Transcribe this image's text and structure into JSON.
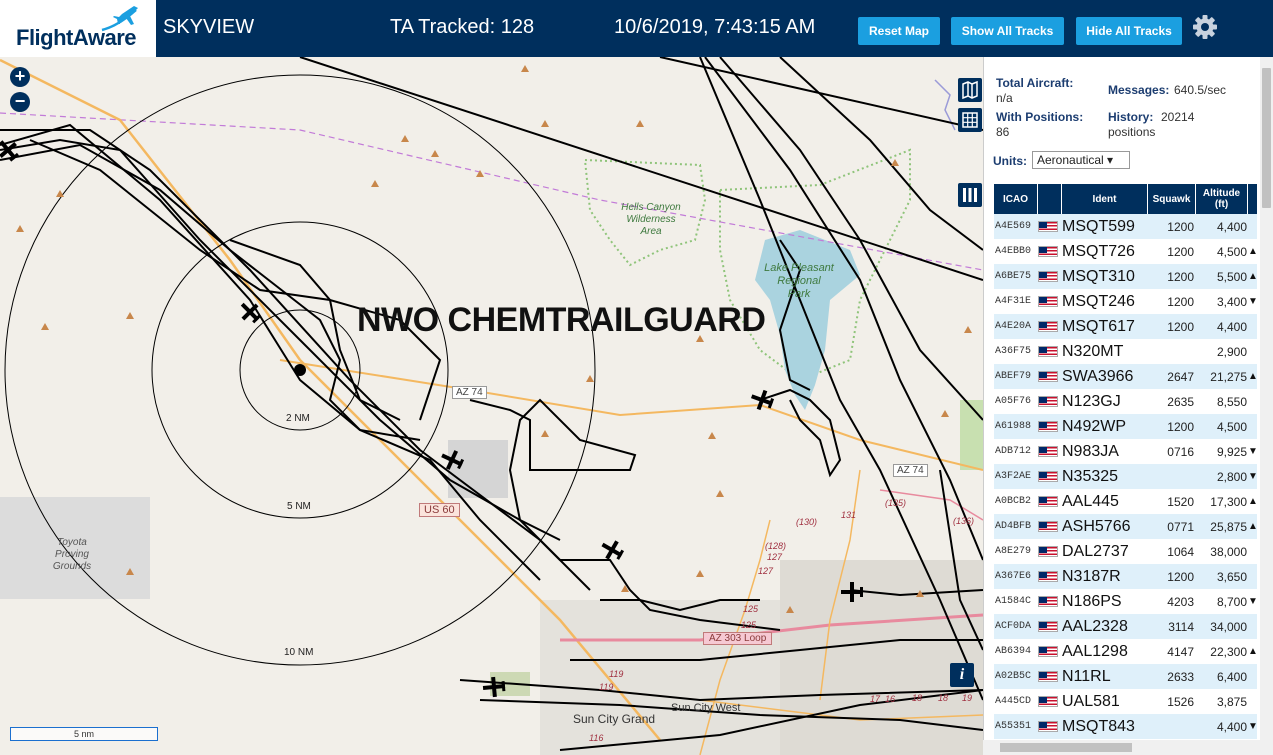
{
  "header": {
    "logo_text": "FlightAware",
    "app_title": "SKYVIEW",
    "ta_tracked": "TA Tracked: 128",
    "datetime": "10/6/2019, 7:43:15 AM",
    "reset_label": "Reset Map",
    "show_label": "Show All Tracks",
    "hide_label": "Hide All Tracks",
    "settings_icon": "gear-icon"
  },
  "map": {
    "overlay_title": "NWO CHEMTRAILGUARD",
    "zoom_in": "+",
    "zoom_out": "−",
    "scale_label": "5 nm",
    "info_label": "i",
    "ring_labels": [
      "2 NM",
      "5 NM",
      "10 NM"
    ],
    "place_labels": {
      "hells_canyon": [
        "Hells Canyon",
        "Wilderness",
        "Area"
      ],
      "lake_pleasant": [
        "Lake Pleasant",
        "Regional",
        "Park"
      ],
      "toyota": [
        "Toyota",
        "Proving",
        "Grounds"
      ],
      "sun_city_grand": "Sun City Grand",
      "sun_city_west": "Sun City West"
    },
    "road_labels": {
      "az74_a": "AZ 74",
      "az74_b": "AZ 74",
      "us60": "US 60",
      "az303": "AZ 303 Loop"
    },
    "route_numbers": [
      "(130)",
      "131",
      "(135)",
      "(136)",
      "(128)",
      "127",
      "127",
      "125",
      "125",
      "119",
      "119",
      "116",
      "17",
      "16",
      "18",
      "18",
      "19"
    ],
    "colors": {
      "track": "#000000",
      "ring": "#000000",
      "road_major": "#f4b860",
      "water": "#aad3df",
      "park_border": "#8fc47a",
      "urban": "#dddddd",
      "boundary": "#c27bd8"
    }
  },
  "sidebar": {
    "total_aircraft_label": "Total Aircraft:",
    "total_aircraft_value": "n/a",
    "with_positions_label": "With Positions:",
    "with_positions_value": "86",
    "messages_label": "Messages:",
    "messages_value": "640.5/sec",
    "history_label": "History:",
    "history_value": "20214",
    "history_unit": "positions",
    "units_label": "Units:",
    "units_value": "Aeronautical ▾",
    "table": {
      "headers": {
        "icao": "ICAO",
        "ident": "Ident",
        "squawk": "Squawk",
        "altitude": "Altitude",
        "altitude_unit": "(ft)"
      },
      "rows": [
        {
          "icao": "A4E569",
          "ident": "MSQT599",
          "squawk": "1200",
          "alt": "4,400",
          "trend": ""
        },
        {
          "icao": "A4EBB0",
          "ident": "MSQT726",
          "squawk": "1200",
          "alt": "4,500",
          "trend": "▲"
        },
        {
          "icao": "A6BE75",
          "ident": "MSQT310",
          "squawk": "1200",
          "alt": "5,500",
          "trend": "▲"
        },
        {
          "icao": "A4F31E",
          "ident": "MSQT246",
          "squawk": "1200",
          "alt": "3,400",
          "trend": "▼"
        },
        {
          "icao": "A4E20A",
          "ident": "MSQT617",
          "squawk": "1200",
          "alt": "4,400",
          "trend": ""
        },
        {
          "icao": "A36F75",
          "ident": "N320MT",
          "squawk": "",
          "alt": "2,900",
          "trend": ""
        },
        {
          "icao": "ABEF79",
          "ident": "SWA3966",
          "squawk": "2647",
          "alt": "21,275",
          "trend": "▲"
        },
        {
          "icao": "A05F76",
          "ident": "N123GJ",
          "squawk": "2635",
          "alt": "8,550",
          "trend": ""
        },
        {
          "icao": "A61988",
          "ident": "N492WP",
          "squawk": "1200",
          "alt": "4,500",
          "trend": ""
        },
        {
          "icao": "ADB712",
          "ident": "N983JA",
          "squawk": "0716",
          "alt": "9,925",
          "trend": "▼"
        },
        {
          "icao": "A3F2AE",
          "ident": "N35325",
          "squawk": "",
          "alt": "2,800",
          "trend": "▼"
        },
        {
          "icao": "A0BCB2",
          "ident": "AAL445",
          "squawk": "1520",
          "alt": "17,300",
          "trend": "▲"
        },
        {
          "icao": "AD4BFB",
          "ident": "ASH5766",
          "squawk": "0771",
          "alt": "25,875",
          "trend": "▲"
        },
        {
          "icao": "A8E279",
          "ident": "DAL2737",
          "squawk": "1064",
          "alt": "38,000",
          "trend": ""
        },
        {
          "icao": "A367E6",
          "ident": "N3187R",
          "squawk": "1200",
          "alt": "3,650",
          "trend": ""
        },
        {
          "icao": "A1584C",
          "ident": "N186PS",
          "squawk": "4203",
          "alt": "8,700",
          "trend": "▼"
        },
        {
          "icao": "ACF0DA",
          "ident": "AAL2328",
          "squawk": "3114",
          "alt": "34,000",
          "trend": ""
        },
        {
          "icao": "AB6394",
          "ident": "AAL1298",
          "squawk": "4147",
          "alt": "22,300",
          "trend": "▲"
        },
        {
          "icao": "A02B5C",
          "ident": "N11RL",
          "squawk": "2633",
          "alt": "6,400",
          "trend": ""
        },
        {
          "icao": "A445CD",
          "ident": "UAL581",
          "squawk": "1526",
          "alt": "3,875",
          "trend": ""
        },
        {
          "icao": "A55351",
          "ident": "MSQT843",
          "squawk": "",
          "alt": "4,400",
          "trend": "▼"
        }
      ]
    }
  }
}
